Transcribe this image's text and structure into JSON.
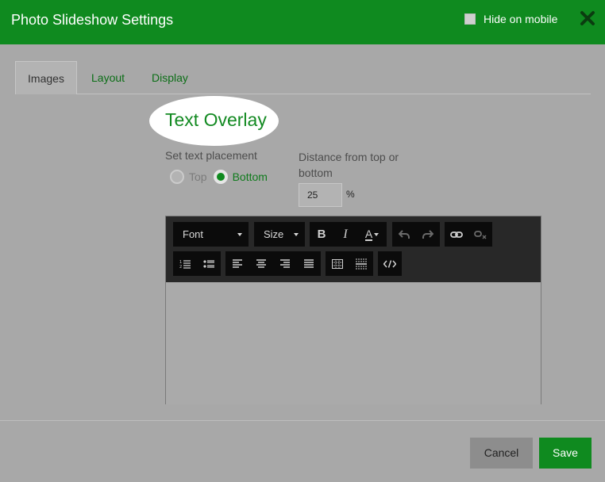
{
  "header": {
    "title": "Photo Slideshow Settings",
    "hide_on_mobile_label": "Hide on mobile",
    "hide_on_mobile_checked": false
  },
  "tabs": [
    {
      "label": "Images",
      "active": true
    },
    {
      "label": "Layout",
      "active": false
    },
    {
      "label": "Display",
      "active": false
    }
  ],
  "text_overlay": {
    "heading": "Text Overlay",
    "placement_label": "Set text placement",
    "placement_options": [
      {
        "label": "Top",
        "selected": false
      },
      {
        "label": "Bottom",
        "selected": true
      }
    ],
    "distance_label": "Distance from top or bottom",
    "distance_value": "25",
    "distance_unit": "%"
  },
  "editor_toolbar": {
    "font_label": "Font",
    "size_label": "Size",
    "icons": [
      "bold-icon",
      "italic-icon",
      "text-color-icon",
      "undo-icon",
      "redo-icon",
      "link-icon",
      "unlink-icon",
      "ordered-list-icon",
      "unordered-list-icon",
      "align-left-icon",
      "align-center-icon",
      "align-right-icon",
      "align-justify-icon",
      "table-icon",
      "horizontal-rule-icon",
      "code-view-icon"
    ]
  },
  "footer": {
    "cancel_label": "Cancel",
    "save_label": "Save"
  },
  "colors": {
    "brand_green": "#0f8a1f",
    "overlay_text_green": "#138a22"
  }
}
